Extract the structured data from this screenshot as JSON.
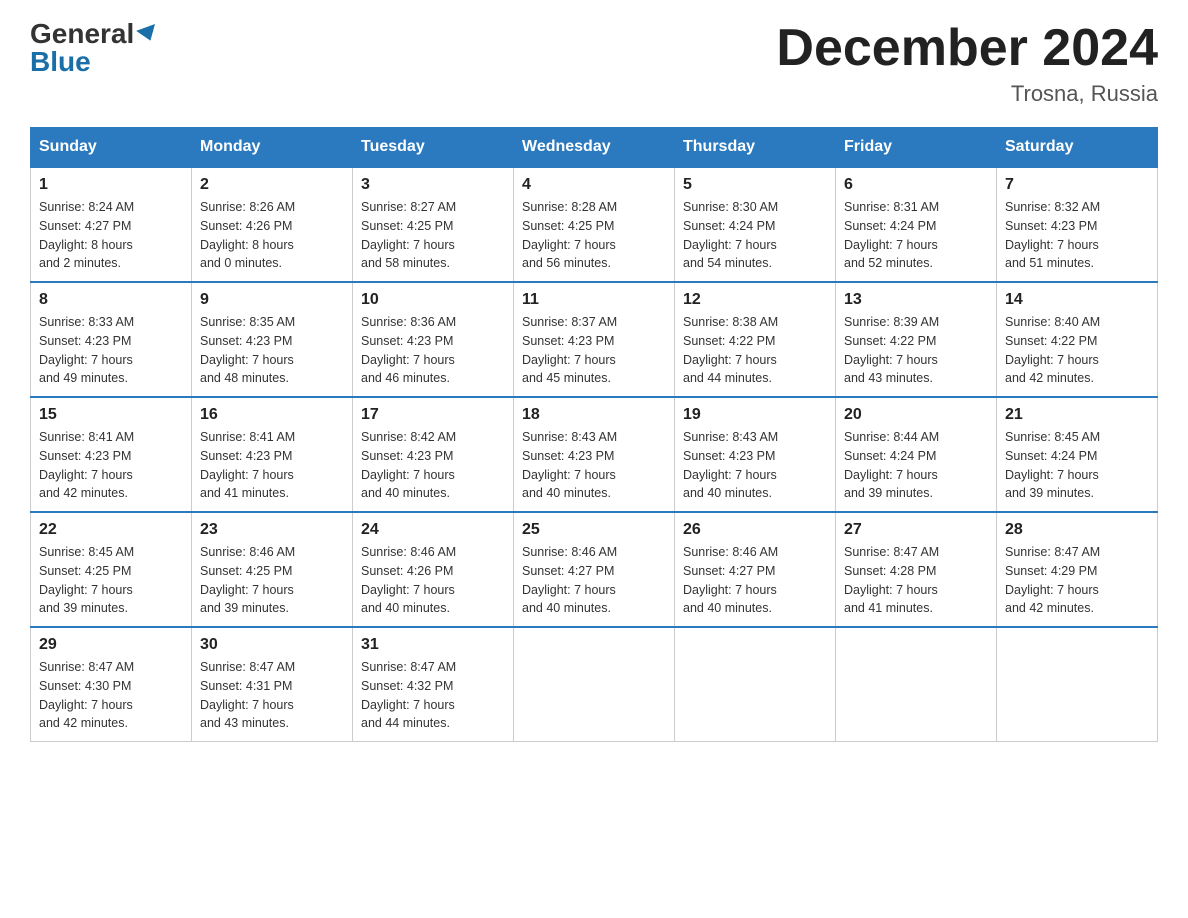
{
  "header": {
    "logo_general": "General",
    "logo_blue": "Blue",
    "month_title": "December 2024",
    "location": "Trosna, Russia"
  },
  "weekdays": [
    "Sunday",
    "Monday",
    "Tuesday",
    "Wednesday",
    "Thursday",
    "Friday",
    "Saturday"
  ],
  "weeks": [
    [
      {
        "day": "1",
        "info": "Sunrise: 8:24 AM\nSunset: 4:27 PM\nDaylight: 8 hours\nand 2 minutes."
      },
      {
        "day": "2",
        "info": "Sunrise: 8:26 AM\nSunset: 4:26 PM\nDaylight: 8 hours\nand 0 minutes."
      },
      {
        "day": "3",
        "info": "Sunrise: 8:27 AM\nSunset: 4:25 PM\nDaylight: 7 hours\nand 58 minutes."
      },
      {
        "day": "4",
        "info": "Sunrise: 8:28 AM\nSunset: 4:25 PM\nDaylight: 7 hours\nand 56 minutes."
      },
      {
        "day": "5",
        "info": "Sunrise: 8:30 AM\nSunset: 4:24 PM\nDaylight: 7 hours\nand 54 minutes."
      },
      {
        "day": "6",
        "info": "Sunrise: 8:31 AM\nSunset: 4:24 PM\nDaylight: 7 hours\nand 52 minutes."
      },
      {
        "day": "7",
        "info": "Sunrise: 8:32 AM\nSunset: 4:23 PM\nDaylight: 7 hours\nand 51 minutes."
      }
    ],
    [
      {
        "day": "8",
        "info": "Sunrise: 8:33 AM\nSunset: 4:23 PM\nDaylight: 7 hours\nand 49 minutes."
      },
      {
        "day": "9",
        "info": "Sunrise: 8:35 AM\nSunset: 4:23 PM\nDaylight: 7 hours\nand 48 minutes."
      },
      {
        "day": "10",
        "info": "Sunrise: 8:36 AM\nSunset: 4:23 PM\nDaylight: 7 hours\nand 46 minutes."
      },
      {
        "day": "11",
        "info": "Sunrise: 8:37 AM\nSunset: 4:23 PM\nDaylight: 7 hours\nand 45 minutes."
      },
      {
        "day": "12",
        "info": "Sunrise: 8:38 AM\nSunset: 4:22 PM\nDaylight: 7 hours\nand 44 minutes."
      },
      {
        "day": "13",
        "info": "Sunrise: 8:39 AM\nSunset: 4:22 PM\nDaylight: 7 hours\nand 43 minutes."
      },
      {
        "day": "14",
        "info": "Sunrise: 8:40 AM\nSunset: 4:22 PM\nDaylight: 7 hours\nand 42 minutes."
      }
    ],
    [
      {
        "day": "15",
        "info": "Sunrise: 8:41 AM\nSunset: 4:23 PM\nDaylight: 7 hours\nand 42 minutes."
      },
      {
        "day": "16",
        "info": "Sunrise: 8:41 AM\nSunset: 4:23 PM\nDaylight: 7 hours\nand 41 minutes."
      },
      {
        "day": "17",
        "info": "Sunrise: 8:42 AM\nSunset: 4:23 PM\nDaylight: 7 hours\nand 40 minutes."
      },
      {
        "day": "18",
        "info": "Sunrise: 8:43 AM\nSunset: 4:23 PM\nDaylight: 7 hours\nand 40 minutes."
      },
      {
        "day": "19",
        "info": "Sunrise: 8:43 AM\nSunset: 4:23 PM\nDaylight: 7 hours\nand 40 minutes."
      },
      {
        "day": "20",
        "info": "Sunrise: 8:44 AM\nSunset: 4:24 PM\nDaylight: 7 hours\nand 39 minutes."
      },
      {
        "day": "21",
        "info": "Sunrise: 8:45 AM\nSunset: 4:24 PM\nDaylight: 7 hours\nand 39 minutes."
      }
    ],
    [
      {
        "day": "22",
        "info": "Sunrise: 8:45 AM\nSunset: 4:25 PM\nDaylight: 7 hours\nand 39 minutes."
      },
      {
        "day": "23",
        "info": "Sunrise: 8:46 AM\nSunset: 4:25 PM\nDaylight: 7 hours\nand 39 minutes."
      },
      {
        "day": "24",
        "info": "Sunrise: 8:46 AM\nSunset: 4:26 PM\nDaylight: 7 hours\nand 40 minutes."
      },
      {
        "day": "25",
        "info": "Sunrise: 8:46 AM\nSunset: 4:27 PM\nDaylight: 7 hours\nand 40 minutes."
      },
      {
        "day": "26",
        "info": "Sunrise: 8:46 AM\nSunset: 4:27 PM\nDaylight: 7 hours\nand 40 minutes."
      },
      {
        "day": "27",
        "info": "Sunrise: 8:47 AM\nSunset: 4:28 PM\nDaylight: 7 hours\nand 41 minutes."
      },
      {
        "day": "28",
        "info": "Sunrise: 8:47 AM\nSunset: 4:29 PM\nDaylight: 7 hours\nand 42 minutes."
      }
    ],
    [
      {
        "day": "29",
        "info": "Sunrise: 8:47 AM\nSunset: 4:30 PM\nDaylight: 7 hours\nand 42 minutes."
      },
      {
        "day": "30",
        "info": "Sunrise: 8:47 AM\nSunset: 4:31 PM\nDaylight: 7 hours\nand 43 minutes."
      },
      {
        "day": "31",
        "info": "Sunrise: 8:47 AM\nSunset: 4:32 PM\nDaylight: 7 hours\nand 44 minutes."
      },
      {
        "day": "",
        "info": ""
      },
      {
        "day": "",
        "info": ""
      },
      {
        "day": "",
        "info": ""
      },
      {
        "day": "",
        "info": ""
      }
    ]
  ]
}
